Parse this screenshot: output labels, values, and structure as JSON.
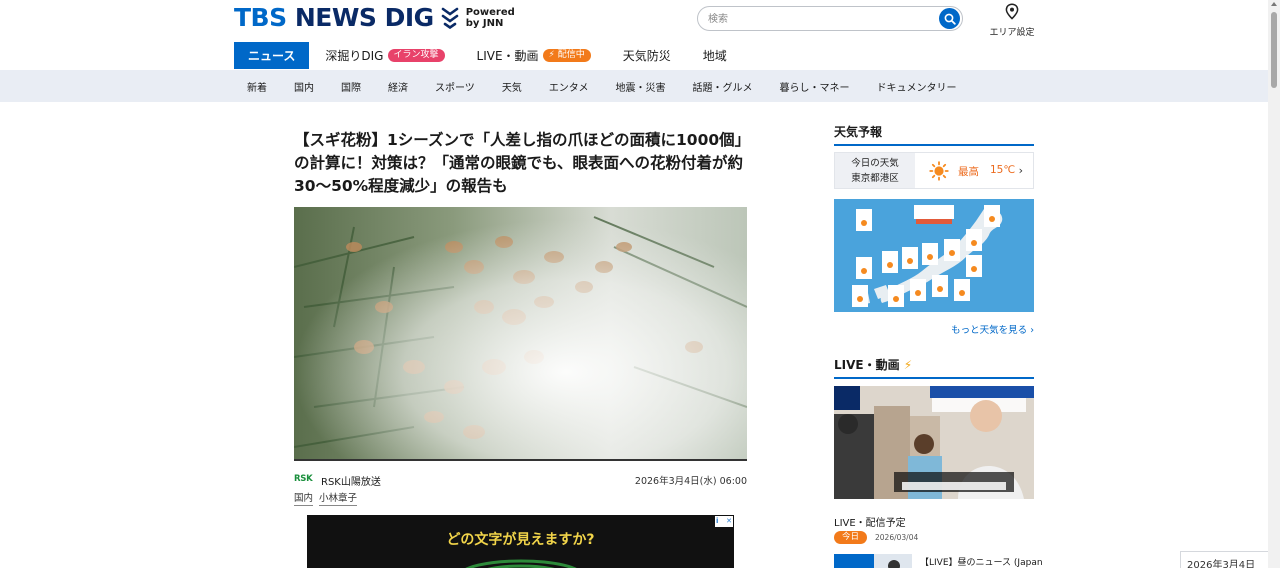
{
  "header": {
    "logo_text_a": "TBS",
    "logo_text_b": "NEWS DIG",
    "powered_line1": "Powered",
    "powered_line2": "by JNN",
    "search_placeholder": "検索",
    "area_setting": "エリア設定"
  },
  "main_nav": [
    {
      "label": "ニュース",
      "active": true
    },
    {
      "label": "深掘りDIG",
      "badge": "イラン攻撃"
    },
    {
      "label": "LIVE・動画",
      "badge": "配信中"
    },
    {
      "label": "天気防災"
    },
    {
      "label": "地域"
    }
  ],
  "sub_nav": [
    "新着",
    "国内",
    "国際",
    "経済",
    "スポーツ",
    "天気",
    "エンタメ",
    "地震・災害",
    "話題・グルメ",
    "暮らし・マネー",
    "ドキュメンタリー"
  ],
  "article": {
    "title": "【スギ花粉】1シーズンで「人差し指の爪ほどの面積に1000個」の計算に！対策は？「通常の眼鏡でも、眼表面への花粉付着が約30〜50%程度減少」の報告も",
    "source_logo": "RSK",
    "source_name": "RSK山陽放送",
    "date": "2026年3月4日(水) 06:00",
    "tags": [
      "国内",
      "小林章子"
    ]
  },
  "ad": {
    "text": "どの文字が見えますか?"
  },
  "sidebar": {
    "weather_heading": "天気予報",
    "today_weather": "今日の天気",
    "location": "東京都港区",
    "max_label": "最高",
    "max_temp": "15℃",
    "more_weather": "もっと天気を見る ›",
    "live_heading": "LIVE・動画",
    "schedule_heading": "LIVE・配信予定",
    "schedule_pill": "今日",
    "schedule_date": "2026/03/04",
    "schedule_title": "【LIVE】昼のニュース (Japan"
  },
  "date_popup": "2026年3月4日",
  "colors": {
    "brand_blue": "#0068c8",
    "badge_pink": "#e8426a",
    "badge_orange": "#f27a1a",
    "subnav_bg": "#e9edf4",
    "temp_orange": "#ec6a1c"
  }
}
